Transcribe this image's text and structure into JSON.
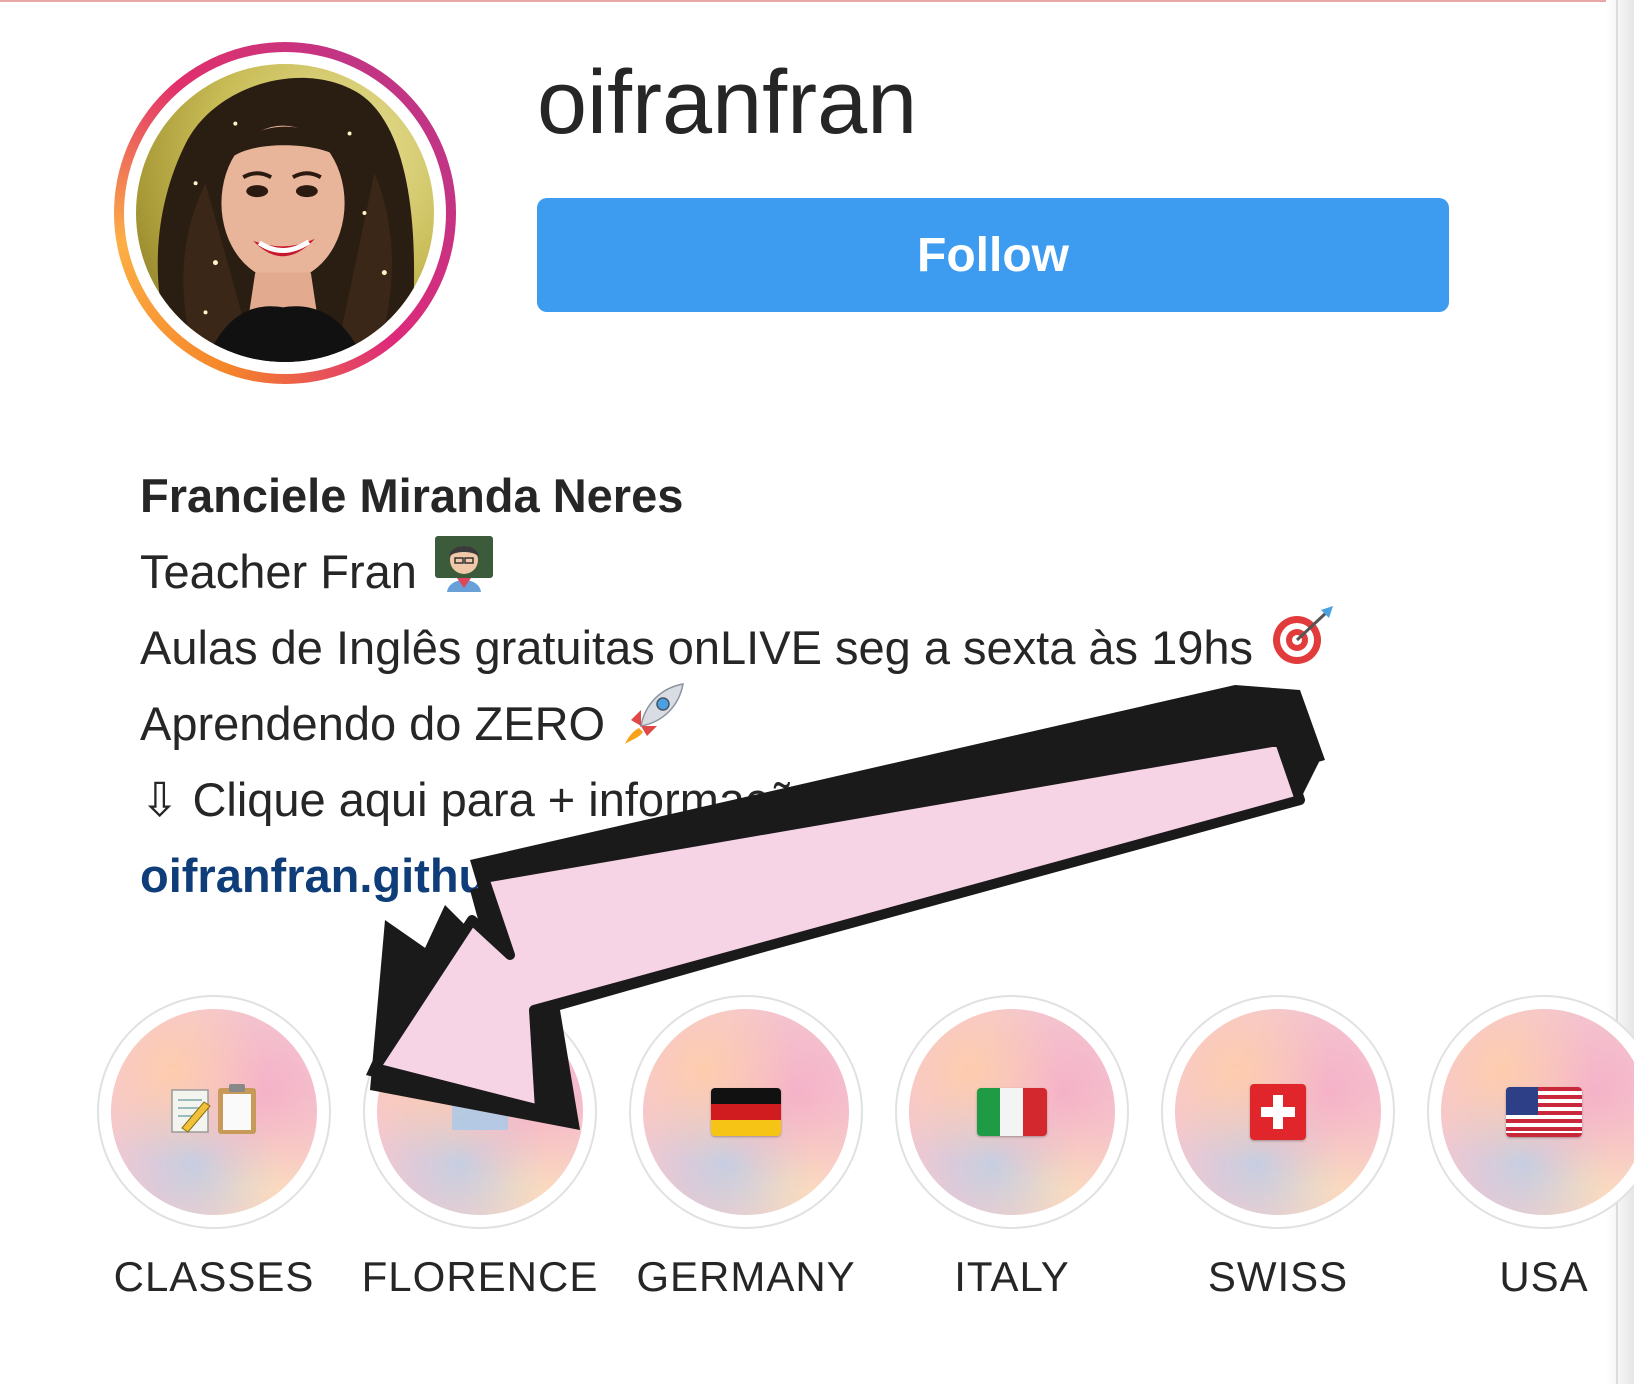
{
  "profile": {
    "username": "oifranfran",
    "follow_label": "Follow",
    "avatar_alt": "profile-photo"
  },
  "bio": {
    "name": "Franciele Miranda Neres",
    "line1": "Teacher Fran",
    "line1_emoji": "teacher-emoji",
    "line2": "Aulas de Inglês gratuitas onLIVE seg a sexta às 19hs",
    "line2_emoji": "target-emoji",
    "line3": "Aprendendo do ZERO",
    "line3_emoji": "rocket-emoji",
    "line4": "⇩ Clique aqui para + informações",
    "link": "oifranfran.github.io/fa"
  },
  "highlights": [
    {
      "label": "CLASSES",
      "icon": "notepad-clipboard-icon"
    },
    {
      "label": "FLORENCE",
      "icon": "picture-icon"
    },
    {
      "label": "GERMANY",
      "icon": "germany-flag-icon"
    },
    {
      "label": "ITALY",
      "icon": "italy-flag-icon"
    },
    {
      "label": "SWISS",
      "icon": "swiss-flag-icon"
    },
    {
      "label": "USA",
      "icon": "usa-flag-icon"
    }
  ],
  "colors": {
    "follow_button": "#3d9bf0",
    "link": "#0f3d7a",
    "arrow_fill": "#f7d3e6",
    "arrow_outline": "#1a1a1a"
  }
}
